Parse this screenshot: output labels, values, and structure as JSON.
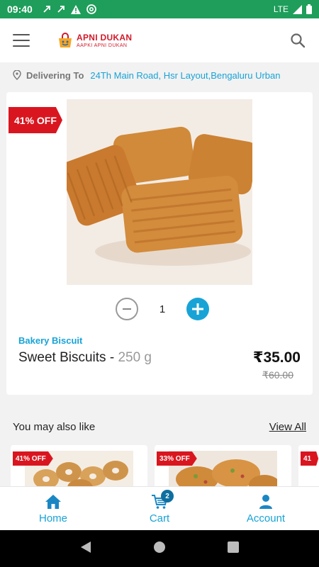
{
  "status_bar": {
    "time": "09:40",
    "network": "LTE",
    "icons": [
      "missed-call-icon",
      "missed-call-icon",
      "warning-icon",
      "at-sign-icon",
      "signal-icon",
      "battery-icon"
    ]
  },
  "header": {
    "logo_name": "APNI DUKAN",
    "logo_tagline": "AAPKI APNI DUKAN"
  },
  "delivery": {
    "label": "Delivering To",
    "address": "24Th Main Road, Hsr Layout,Bengaluru Urban"
  },
  "product": {
    "discount_badge": "41% OFF",
    "quantity": "1",
    "category": "Bakery Biscuit",
    "name": "Sweet Biscuits - ",
    "weight": "250 g",
    "price": "₹35.00",
    "mrp": "₹60.00"
  },
  "recommendations": {
    "title": "You may also like",
    "view_all": "View All",
    "items": [
      {
        "badge": "41% OFF"
      },
      {
        "badge": "33% OFF"
      },
      {
        "badge": "41"
      }
    ]
  },
  "bottom_nav": {
    "home": "Home",
    "cart": "Cart",
    "cart_count": "2",
    "account": "Account"
  },
  "colors": {
    "status_bar": "#1e9e5a",
    "accent": "#18a3d6",
    "discount_red": "#d9161f",
    "brand_red": "#d11a2a"
  }
}
